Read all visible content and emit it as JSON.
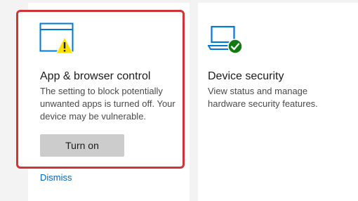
{
  "cards": [
    {
      "title": "App & browser control",
      "description": "The setting to block potentially unwanted apps is turned off. Your device may be vulnerable.",
      "icon": "app-browser-warning-icon",
      "action_label": "Turn on",
      "dismiss_label": "Dismiss",
      "status": "warning"
    },
    {
      "title": "Device security",
      "description": "View status and manage hardware security features.",
      "icon": "device-security-check-icon",
      "status": "ok"
    }
  ],
  "colors": {
    "accent": "#0067c0",
    "icon_blue": "#0078d4",
    "warning": "#fce100",
    "ok": "#107c10",
    "highlight_border": "#d13438",
    "button_bg": "#cccccc"
  }
}
